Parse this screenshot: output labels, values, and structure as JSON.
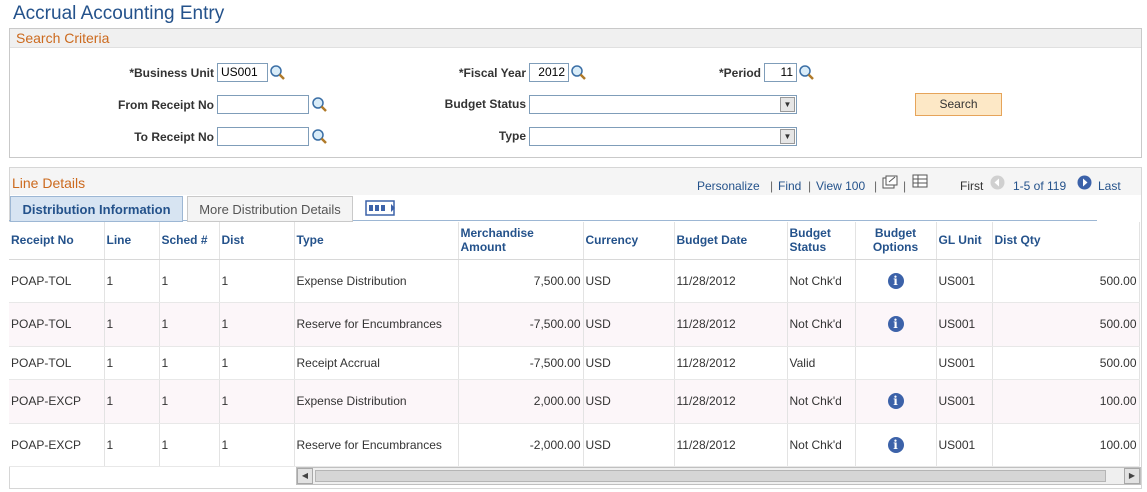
{
  "page_title": "Accrual Accounting Entry",
  "search": {
    "header": "Search Criteria",
    "business_unit_label": "*Business Unit",
    "business_unit_value": "US001",
    "fiscal_year_label": "*Fiscal Year",
    "fiscal_year_value": "2012",
    "period_label": "*Period",
    "period_value": "11",
    "from_receipt_label": "From Receipt No",
    "from_receipt_value": "",
    "to_receipt_label": "To Receipt No",
    "to_receipt_value": "",
    "budget_status_label": "Budget Status",
    "budget_status_value": "",
    "type_label": "Type",
    "type_value": "",
    "search_button": "Search"
  },
  "line_details": {
    "title": "Line Details",
    "personalize": "Personalize",
    "find": "Find",
    "view100": "View 100",
    "sep": "|",
    "first": "First",
    "range": "1-5 of 119",
    "last": "Last",
    "tabs": [
      "Distribution Information",
      "More Distribution Details"
    ]
  },
  "table": {
    "headers": [
      "Receipt No",
      "Line",
      "Sched #",
      "Dist",
      "Type",
      "Merchandise Amount",
      "Currency",
      "Budget Date",
      "Budget Status",
      "Budget Options",
      "GL Unit",
      "Dist Qty"
    ],
    "rows": [
      [
        "POAP-TOL",
        "1",
        "1",
        "1",
        "Expense Distribution",
        "7,500.00",
        "USD",
        "11/28/2012",
        "Not Chk'd",
        "i",
        "US001",
        "500.00"
      ],
      [
        "POAP-TOL",
        "1",
        "1",
        "1",
        "Reserve for Encumbrances",
        "-7,500.00",
        "USD",
        "11/28/2012",
        "Not Chk'd",
        "i",
        "US001",
        "500.00"
      ],
      [
        "POAP-TOL",
        "1",
        "1",
        "1",
        "Receipt Accrual",
        "-7,500.00",
        "USD",
        "11/28/2012",
        "Valid",
        "",
        "US001",
        "500.00"
      ],
      [
        "POAP-EXCP",
        "1",
        "1",
        "1",
        "Expense Distribution",
        "2,000.00",
        "USD",
        "11/28/2012",
        "Not Chk'd",
        "i",
        "US001",
        "100.00"
      ],
      [
        "POAP-EXCP",
        "1",
        "1",
        "1",
        "Reserve for Encumbrances",
        "-2,000.00",
        "USD",
        "11/28/2012",
        "Not Chk'd",
        "i",
        "US001",
        "100.00"
      ]
    ]
  },
  "icons": {
    "lookup": "magnifier-icon",
    "info": "info-icon",
    "dropdown": "chevron-down-icon"
  },
  "colors": {
    "title": "#24528b",
    "section_header": "#cc6a1e",
    "search_button_bg": "#fde8c6",
    "info_icon": "#3c62a9"
  }
}
